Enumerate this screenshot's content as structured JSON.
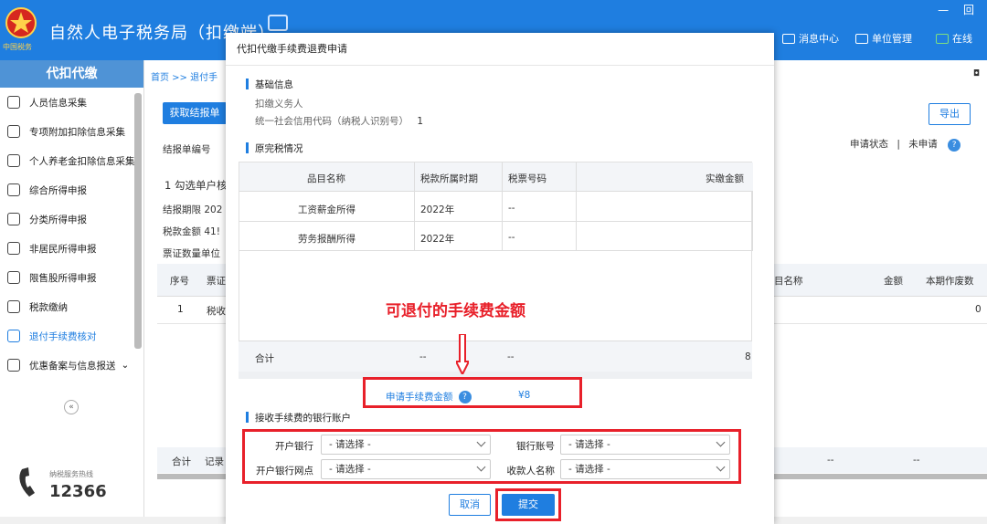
{
  "app": {
    "title": "自然人电子税务局（扣缴端）",
    "logo_text": "中国税务",
    "window_controls": "— 回"
  },
  "topnav": {
    "items": [
      {
        "label": "消息中心",
        "icon": "mail-icon"
      },
      {
        "label": "单位管理",
        "icon": "building-icon"
      },
      {
        "label": "在线",
        "icon": "monitor-icon"
      }
    ]
  },
  "sidebar": {
    "header": "代扣代缴",
    "items": [
      {
        "label": "人员信息采集",
        "icon": "person-icon"
      },
      {
        "label": "专项附加扣除信息采集",
        "icon": "list-icon"
      },
      {
        "label": "个人养老金扣除信息采集",
        "icon": "card-icon"
      },
      {
        "label": "综合所得申报",
        "icon": "layers-icon"
      },
      {
        "label": "分类所得申报",
        "icon": "pie-icon"
      },
      {
        "label": "非居民所得申报",
        "icon": "user-outline-icon"
      },
      {
        "label": "限售股所得申报",
        "icon": "bars-icon"
      },
      {
        "label": "税款缴纳",
        "icon": "wallet-icon"
      },
      {
        "label": "退付手续费核对",
        "icon": "receipt-icon",
        "active": true
      },
      {
        "label": "优惠备案与信息报送",
        "icon": "file-icon"
      }
    ],
    "collapse": "«",
    "hotline_label": "纳税服务热线",
    "hotline_number": "12366"
  },
  "main": {
    "breadcrumb": "首页 >> 退付手",
    "get_report_button": "获取结报单",
    "export_button": "导出",
    "report_no_label": "结报单编号",
    "hint": "1 勾选单户核",
    "period": "结报期限  202",
    "amount": "税款金额  41!",
    "unit": "票证数量单位",
    "status_label": "申请状态",
    "status_sep": "|",
    "status_value": "未申请",
    "help": "?",
    "table_headers": [
      "序号",
      "票证",
      "目名称",
      "金额",
      "本期作废数"
    ],
    "table_row": [
      "1",
      "税收",
      "0"
    ],
    "footer": [
      "合计",
      "记录",
      "--",
      "--"
    ]
  },
  "modal": {
    "title": "代扣代缴手续费退费申请",
    "basic_section": "基础信息",
    "withholding_agent_label": "扣缴义务人",
    "credit_code_label": "统一社会信用代码（纳税人识别号）",
    "credit_code_value": "1",
    "tax_section": "原完税情况",
    "table_headers": [
      "品目名称",
      "税款所属时期",
      "税票号码",
      "实缴金额"
    ],
    "rows": [
      {
        "item": "工资薪金所得",
        "period": "2022年",
        "ticket": "--"
      },
      {
        "item": "劳务报酬所得",
        "period": "2022年",
        "ticket": "--"
      }
    ],
    "total_row": {
      "label": "合计",
      "period": "--",
      "ticket": "--",
      "amount": "8"
    },
    "annotation": "可退付的手续费金额",
    "apply_amount_label": "申请手续费金额",
    "apply_amount_value": "¥8",
    "bank_section": "接收手续费的银行账户",
    "bank_label": "开户银行",
    "account_label": "银行账号",
    "branch_label": "开户银行网点",
    "payee_label": "收款人名称",
    "select_placeholder": "- 请选择 -",
    "cancel_button": "取消",
    "submit_button": "提交",
    "colors": {
      "accent": "#1f7ee0",
      "highlight": "#e8202a"
    }
  }
}
